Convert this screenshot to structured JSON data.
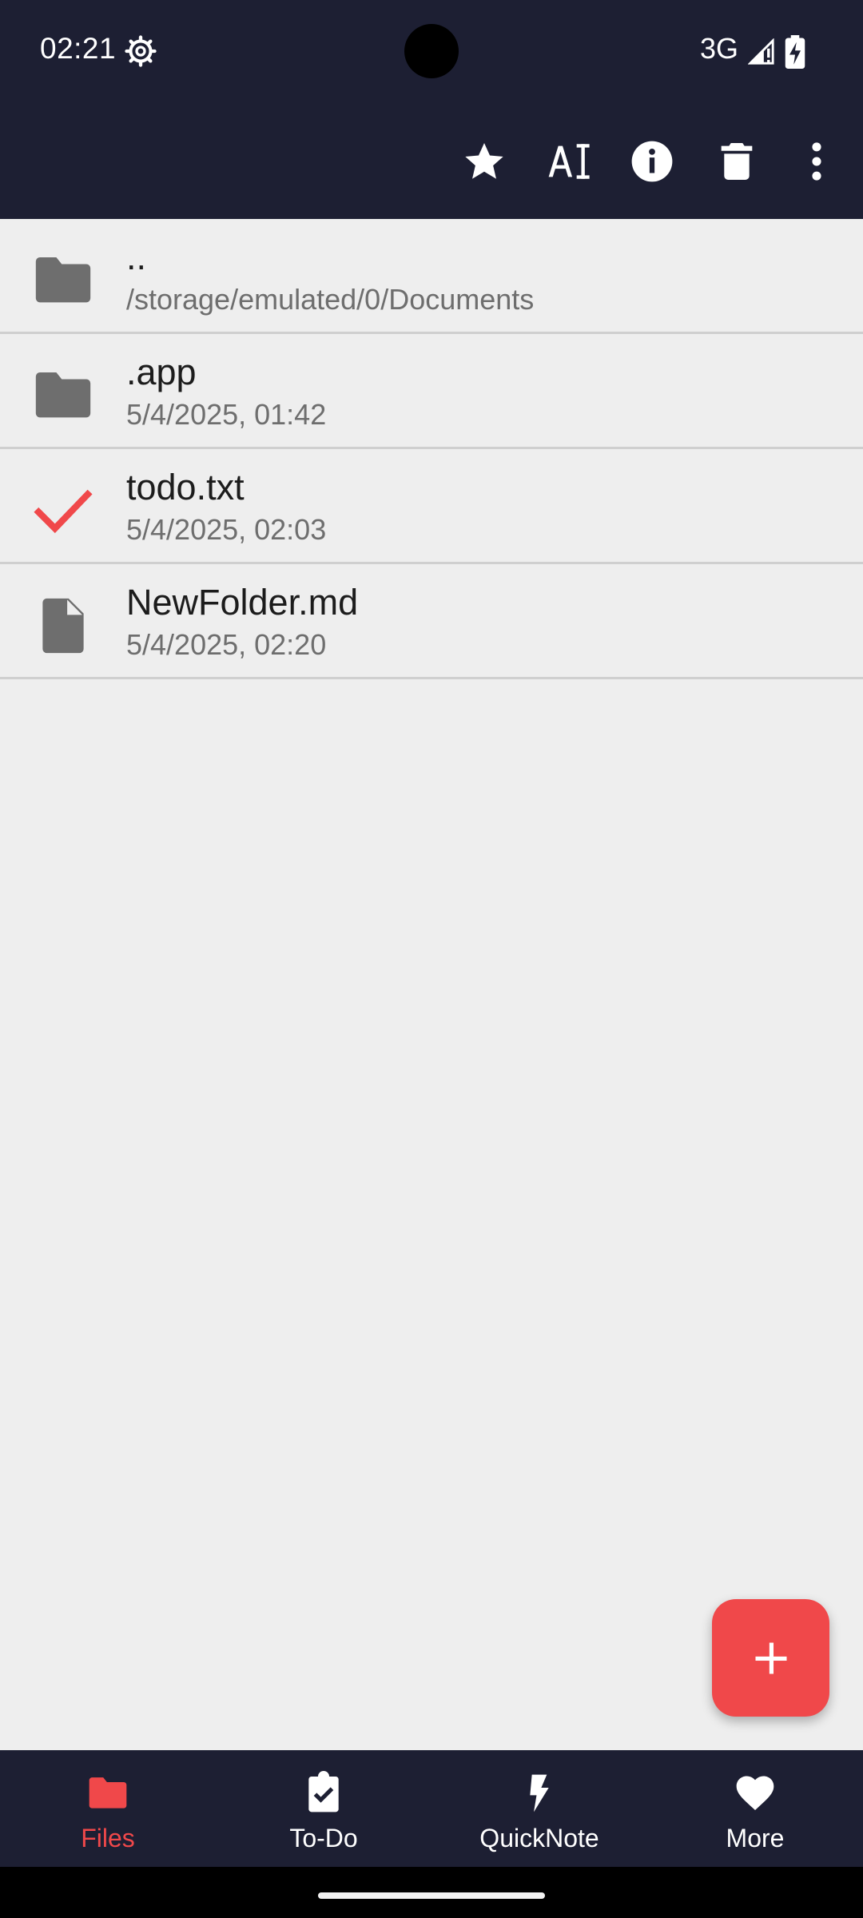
{
  "status_bar": {
    "time": "02:21",
    "network": "3G",
    "icons": [
      "settings-gear-icon",
      "signal-icon",
      "battery-charging-icon"
    ]
  },
  "toolbar": {
    "actions": [
      {
        "icon": "star-icon",
        "label": "Favorite"
      },
      {
        "icon": "rename-icon",
        "label": "Rename"
      },
      {
        "icon": "info-icon",
        "label": "Info"
      },
      {
        "icon": "delete-icon",
        "label": "Delete"
      },
      {
        "icon": "more-vert-icon",
        "label": "More options"
      }
    ]
  },
  "files": [
    {
      "name": "..",
      "subtitle": "/storage/emulated/0/Documents",
      "icon": "folder-icon",
      "selected": false
    },
    {
      "name": ".app",
      "subtitle": "5/4/2025, 01:42",
      "icon": "folder-icon",
      "selected": false
    },
    {
      "name": "todo.txt",
      "subtitle": "5/4/2025, 02:03",
      "icon": "checkmark-icon",
      "selected": true
    },
    {
      "name": "NewFolder.md",
      "subtitle": "5/4/2025, 02:20",
      "icon": "file-icon",
      "selected": false
    }
  ],
  "fab": {
    "icon": "plus-icon"
  },
  "bottom_nav": {
    "items": [
      {
        "label": "Files",
        "icon": "folder-icon",
        "active": true
      },
      {
        "label": "To-Do",
        "icon": "clipboard-check-icon",
        "active": false
      },
      {
        "label": "QuickNote",
        "icon": "lightning-icon",
        "active": false
      },
      {
        "label": "More",
        "icon": "heart-icon",
        "active": false
      }
    ]
  },
  "colors": {
    "bar_background": "#1d1f33",
    "accent": "#f0484a",
    "list_background": "#eeeeee",
    "divider": "#cfcfcf",
    "icon_gray": "#6e6e6e"
  }
}
